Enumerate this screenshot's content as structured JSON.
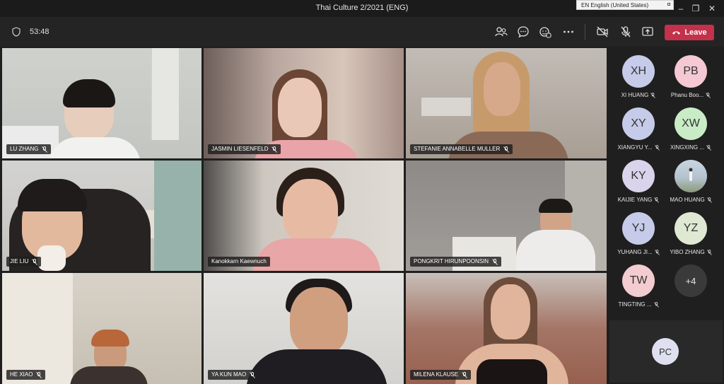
{
  "window": {
    "title": "Thai Culture 2/2021 (ENG)",
    "language_indicator": "EN English (United States)",
    "minimize": "–",
    "maximize": "❐",
    "close": "✕"
  },
  "toolbar": {
    "meeting_timer": "53:48",
    "leave_label": "Leave"
  },
  "participants": [
    {
      "name": "LU ZHANG",
      "bg": "#c7c9c6"
    },
    {
      "name": "JASMIN LIESENFELD",
      "bg": "#c9b3aa"
    },
    {
      "name": "STEFANIE ANNABELLE MULLER",
      "bg": "#b7aea6"
    },
    {
      "name": "JIE LIU",
      "bg": "#c9c7c2"
    },
    {
      "name": "Kanokkarn Kaewnuch",
      "bg": "#b8b3ab"
    },
    {
      "name": "PONGKRIT HIRUNPOONSIN",
      "bg": "#9a9693"
    },
    {
      "name": "HE XIAO",
      "bg": "#cfc9bf"
    },
    {
      "name": "YA KUN MAO",
      "bg": "#d9d8d4"
    },
    {
      "name": "MILENA KLAUSE",
      "bg": "#a7847a"
    }
  ],
  "roster": [
    {
      "initials": "XH",
      "name": "XI HUANG",
      "color": "#c5cbe8"
    },
    {
      "initials": "PB",
      "name": "Phanu Boo...",
      "color": "#f4c9d3"
    },
    {
      "initials": "XY",
      "name": "XIANGYU Y...",
      "color": "#c5cbe8"
    },
    {
      "initials": "XW",
      "name": "XINGXING ...",
      "color": "#c9ecc6"
    },
    {
      "initials": "KY",
      "name": "KAIJIE YANG",
      "color": "#d9d3ec"
    },
    {
      "initials": "",
      "name": "MAO HUANG",
      "color": "#b9c9d6"
    },
    {
      "initials": "YJ",
      "name": "YUHANG JI...",
      "color": "#c5cbe8"
    },
    {
      "initials": "YZ",
      "name": "YIBO ZHANG",
      "color": "#dfe8d3"
    },
    {
      "initials": "TW",
      "name": "TINGTING ...",
      "color": "#f2ccd0"
    },
    {
      "initials": "+4",
      "name": "",
      "color": "#3a3a3a"
    }
  ],
  "self_view": {
    "initials": "PC"
  },
  "colors": {
    "leave": "#c4314b",
    "active_outline": "#6264a7"
  }
}
